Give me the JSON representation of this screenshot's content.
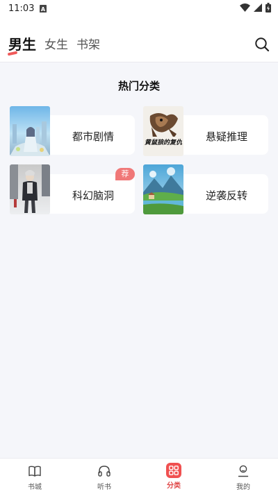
{
  "status_bar": {
    "time": "11:03"
  },
  "header": {
    "tabs": [
      {
        "label": "男生",
        "active": true
      },
      {
        "label": "女生",
        "active": false
      },
      {
        "label": "书架",
        "active": false
      }
    ],
    "search_icon": "search-icon"
  },
  "section": {
    "title": "热门分类",
    "categories": [
      {
        "label": "都市剧情",
        "cover": "anime city girl",
        "badge": ""
      },
      {
        "label": "悬疑推理",
        "cover": "squirrel poster",
        "cover_text": "黄鼠狼的复仇",
        "badge": ""
      },
      {
        "label": "科幻脑洞",
        "cover": "urban man in snow",
        "badge": "荐"
      },
      {
        "label": "逆袭反转",
        "cover": "mountain lake village",
        "badge": ""
      }
    ]
  },
  "bottom_nav": {
    "items": [
      {
        "label": "书城",
        "icon": "book-icon",
        "active": false
      },
      {
        "label": "听书",
        "icon": "headphones-icon",
        "active": false
      },
      {
        "label": "分类",
        "icon": "grid-icon",
        "active": true
      },
      {
        "label": "我的",
        "icon": "user-icon",
        "active": false
      }
    ]
  },
  "colors": {
    "accent": "#f05050",
    "background": "#f5f6fa",
    "card": "#ffffff",
    "badge": "#f07878"
  }
}
